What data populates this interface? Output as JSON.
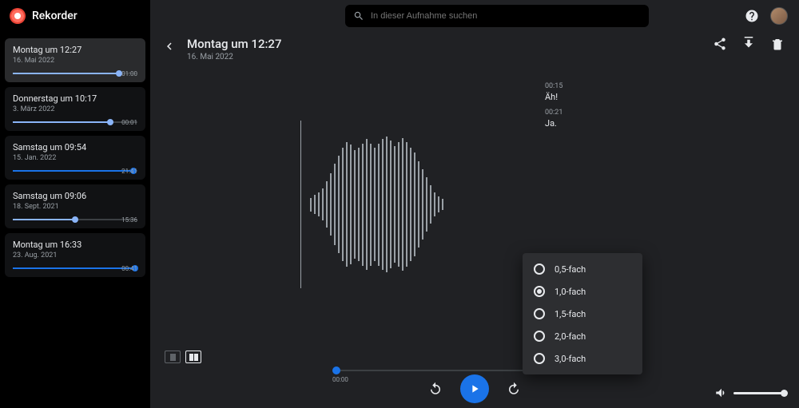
{
  "brand": {
    "name": "Rekorder"
  },
  "search": {
    "placeholder": "In dieser Aufnahme suchen"
  },
  "sidebar": {
    "items": [
      {
        "title": "Montag um 12:27",
        "date": "16. Mai 2022",
        "duration": "01:00",
        "progress": 0.85,
        "selected": true
      },
      {
        "title": "Donnerstag um 10:17",
        "date": "3. März 2022",
        "duration": "00:01",
        "progress": 0.78
      },
      {
        "title": "Samstag um 09:54",
        "date": "15. Jan. 2022",
        "duration": "21:41",
        "progress": 0.97,
        "accent": true
      },
      {
        "title": "Samstag um 09:06",
        "date": "18. Sept. 2021",
        "duration": "15:36",
        "progress": 0.5
      },
      {
        "title": "Montag um 16:33",
        "date": "23. Aug. 2021",
        "duration": "00:41",
        "progress": 0.98,
        "accent": true
      }
    ]
  },
  "recording": {
    "title": "Montag um 12:27",
    "date": "16. Mai 2022"
  },
  "transcript": [
    {
      "time": "00:15",
      "text": "Äh!"
    },
    {
      "time": "00:21",
      "text": "Ja."
    }
  ],
  "playback": {
    "current_time": "00:00",
    "speed_options": [
      {
        "label": "0,5-fach",
        "selected": false
      },
      {
        "label": "1,0-fach",
        "selected": true
      },
      {
        "label": "1,5-fach",
        "selected": false
      },
      {
        "label": "2,0-fach",
        "selected": false
      },
      {
        "label": "3,0-fach",
        "selected": false
      }
    ]
  },
  "colors": {
    "accent": "#1a73e8",
    "accent_light": "#8ab4f8"
  }
}
